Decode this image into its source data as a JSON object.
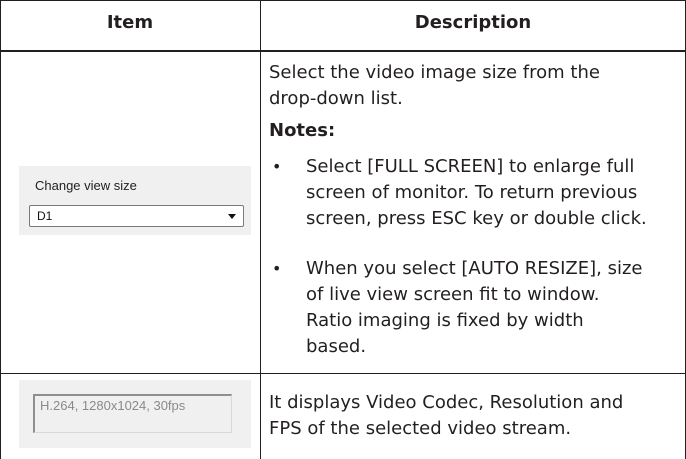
{
  "table": {
    "headers": {
      "item": "Item",
      "description": "Description"
    },
    "rows": [
      {
        "widget": {
          "label": "Change view size",
          "select_value": "D1"
        },
        "description": {
          "lines": [
            "Select the video image size from the",
            "drop-down list."
          ],
          "notes_heading": "Notes:",
          "bullets": [
            {
              "lines": [
                "Select [FULL SCREEN] to enlarge full",
                "screen of monitor. To return previous",
                "screen, press ESC key or double click."
              ]
            },
            {
              "lines": [
                "When you select [AUTO RESIZE], size",
                "of live view screen fit to window.",
                "Ratio imaging is fixed by width",
                "based."
              ]
            }
          ]
        }
      },
      {
        "widget": {
          "info_text": "H.264, 1280x1024, 30fps"
        },
        "description": {
          "lines": [
            "It displays Video Codec, Resolution and",
            "FPS of the selected video stream."
          ]
        }
      }
    ]
  }
}
